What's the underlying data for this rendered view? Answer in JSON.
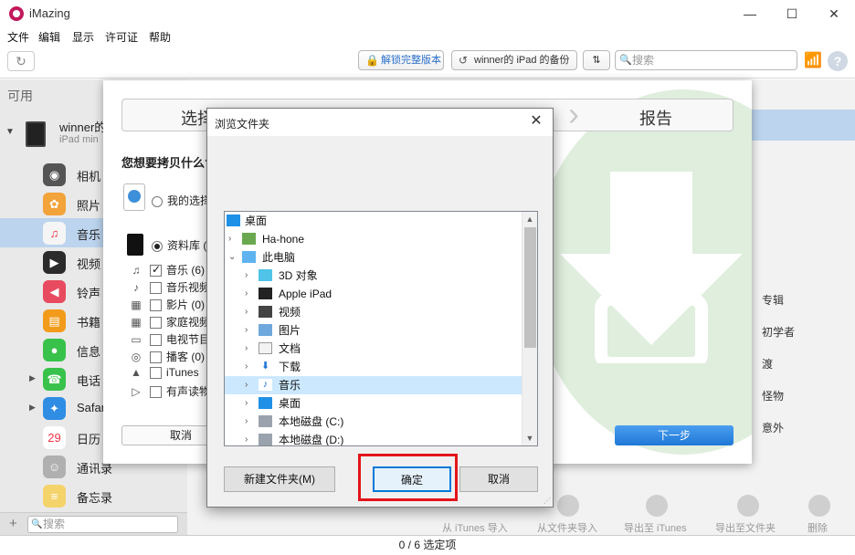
{
  "app": {
    "title": "iMazing"
  },
  "window": {
    "minimize": "—",
    "maximize": "☐",
    "close": "✕"
  },
  "menu": [
    "文件",
    "编辑",
    "显示",
    "许可证",
    "帮助"
  ],
  "toolbar": {
    "refresh": "↻",
    "unlock": "解锁完整版本",
    "backup": "winner的 iPad 的备份",
    "sync": "⇅",
    "search_placeholder": "搜索",
    "help": "?"
  },
  "sidebar": {
    "available": "可用",
    "device_name": "winner的",
    "device_model": "iPad min",
    "items": [
      {
        "label": "相机",
        "color": "#555555",
        "glyph": "◉"
      },
      {
        "label": "照片",
        "color": "#f2a33a",
        "glyph": "✿"
      },
      {
        "label": "音乐",
        "color": "#f5f5f5",
        "glyph": "♫"
      },
      {
        "label": "视频",
        "color": "#2b2b2b",
        "glyph": "▶"
      },
      {
        "label": "铃声",
        "color": "#e84a5f",
        "glyph": "◀"
      },
      {
        "label": "书籍",
        "color": "#f29b1a",
        "glyph": "▤"
      },
      {
        "label": "信息",
        "color": "#39c24b",
        "glyph": "●"
      },
      {
        "label": "电话",
        "color": "#39c24b",
        "glyph": "☎"
      },
      {
        "label": "Safari",
        "color": "#2f8de4",
        "glyph": "✦"
      },
      {
        "label": "日历",
        "color": "#ffffff",
        "glyph": "29"
      },
      {
        "label": "通讯录",
        "color": "#b0b0b0",
        "glyph": "☺"
      },
      {
        "label": "备忘录",
        "color": "#f5d36b",
        "glyph": "≡"
      }
    ],
    "search_placeholder": "搜索",
    "add": "+"
  },
  "right_panel": [
    "专辑",
    "初学者",
    "渡",
    "怪物",
    "意外"
  ],
  "bottom_actions": [
    "从 iTunes 导入",
    "从文件夹导入",
    "导出至 iTunes",
    "导出至文件夹",
    "删除"
  ],
  "status": "0 / 6 选定项",
  "wizard": {
    "steps": [
      "选择",
      "报告"
    ],
    "question": "您想要拷贝什么?",
    "options": [
      {
        "label": "我的选择",
        "selected": false
      },
      {
        "label": "资料库 (",
        "selected": true
      }
    ],
    "library": [
      {
        "label": "音乐 (6)",
        "checked": true,
        "icon": "♫"
      },
      {
        "label": "音乐视频",
        "checked": false,
        "icon": "♪"
      },
      {
        "label": "影片 (0)",
        "checked": false,
        "icon": "▦"
      },
      {
        "label": "家庭视频",
        "checked": false,
        "icon": "▦"
      },
      {
        "label": "电视节目",
        "checked": false,
        "icon": "▭"
      },
      {
        "label": "播客 (0)",
        "checked": false,
        "icon": "◎"
      },
      {
        "label": "iTunes",
        "checked": false,
        "icon": "▲"
      },
      {
        "label": "有声读物",
        "checked": false,
        "icon": "▷"
      }
    ],
    "cancel": "取消",
    "next": "下一步"
  },
  "folder_dialog": {
    "title": "浏览文件夹",
    "close": "✕",
    "tree": [
      {
        "label": "桌面",
        "level": 0,
        "arrow": "",
        "icon": "desktop",
        "selected": false
      },
      {
        "label": "Ha-hone",
        "level": 1,
        "arrow": "›",
        "icon": "user",
        "selected": false
      },
      {
        "label": "此电脑",
        "level": 1,
        "arrow": "⌄",
        "icon": "pc",
        "selected": false
      },
      {
        "label": "3D 对象",
        "level": 2,
        "arrow": "›",
        "icon": "3d",
        "selected": false
      },
      {
        "label": "Apple iPad",
        "level": 2,
        "arrow": "›",
        "icon": "ipad",
        "selected": false
      },
      {
        "label": "视频",
        "level": 2,
        "arrow": "›",
        "icon": "video",
        "selected": false
      },
      {
        "label": "图片",
        "level": 2,
        "arrow": "›",
        "icon": "picture",
        "selected": false
      },
      {
        "label": "文档",
        "level": 2,
        "arrow": "›",
        "icon": "doc",
        "selected": false
      },
      {
        "label": "下载",
        "level": 2,
        "arrow": "›",
        "icon": "download",
        "selected": false
      },
      {
        "label": "音乐",
        "level": 2,
        "arrow": "›",
        "icon": "music",
        "selected": true
      },
      {
        "label": "桌面",
        "level": 2,
        "arrow": "›",
        "icon": "desktop",
        "selected": false
      },
      {
        "label": "本地磁盘 (C:)",
        "level": 2,
        "arrow": "›",
        "icon": "disk",
        "selected": false
      },
      {
        "label": "本地磁盘 (D:)",
        "level": 2,
        "arrow": "›",
        "icon": "disk",
        "selected": false
      }
    ],
    "new_folder": "新建文件夹(M)",
    "ok": "确定",
    "cancel": "取消"
  }
}
